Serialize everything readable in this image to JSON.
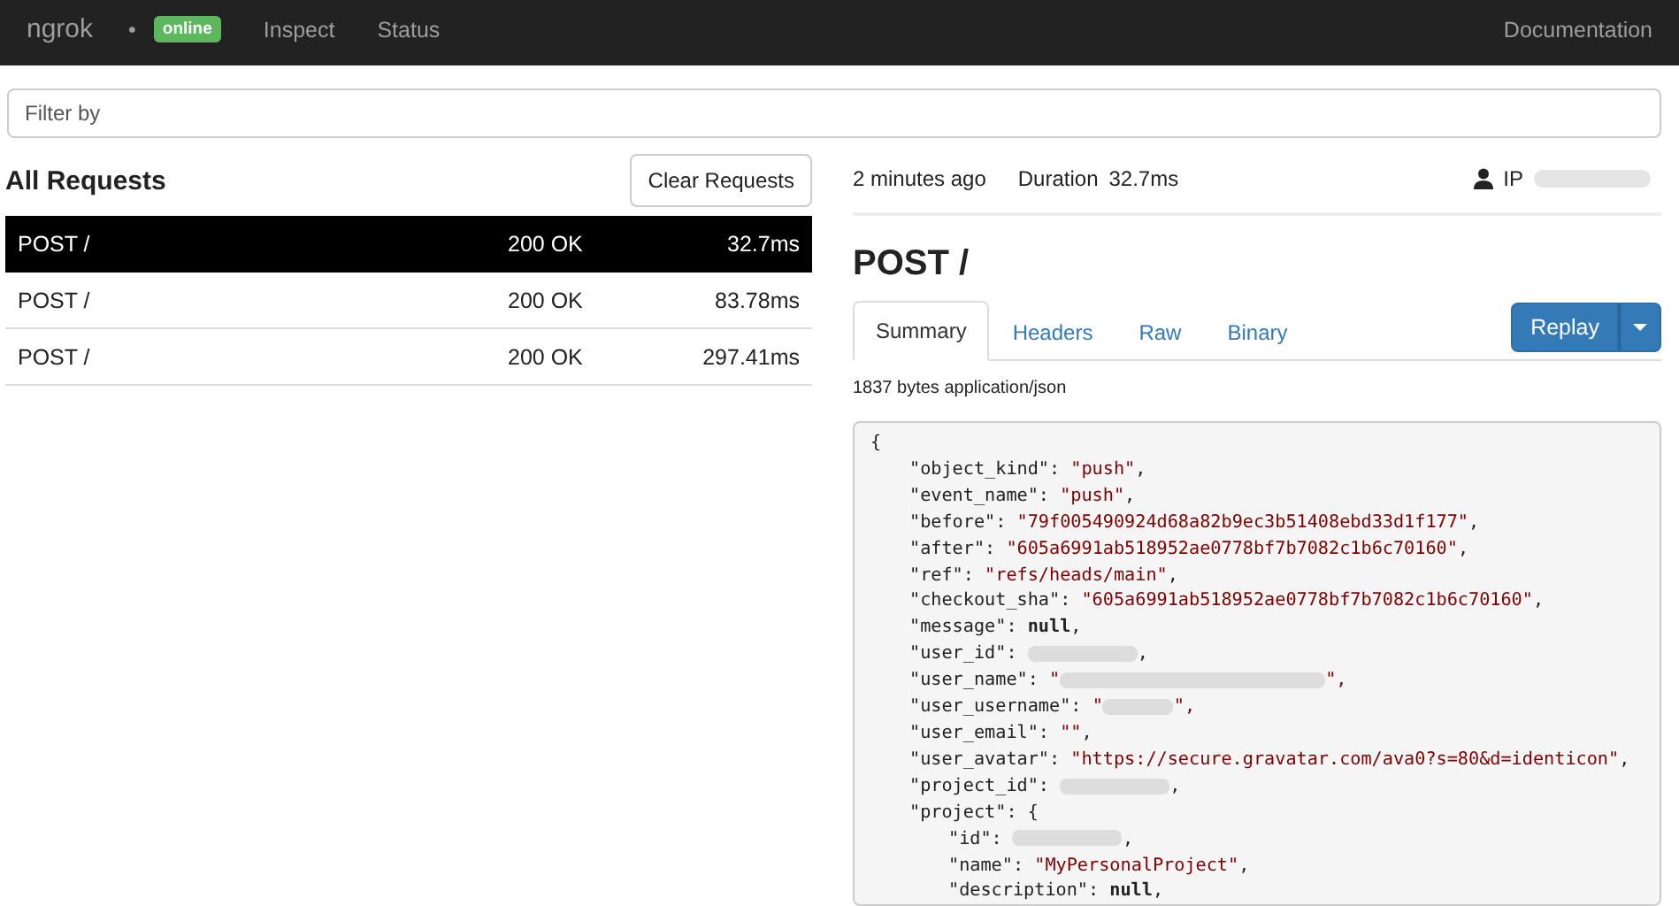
{
  "navbar": {
    "brand": "ngrok",
    "separator": "•",
    "status_badge": "online",
    "links": [
      {
        "label": "Inspect"
      },
      {
        "label": "Status"
      }
    ],
    "right_link": "Documentation"
  },
  "filter": {
    "placeholder": "Filter by"
  },
  "requests": {
    "title": "All Requests",
    "clear_button": "Clear Requests",
    "rows": [
      {
        "method": "POST /",
        "status": "200 OK",
        "duration": "32.7ms",
        "selected": true
      },
      {
        "method": "POST /",
        "status": "200 OK",
        "duration": "83.78ms",
        "selected": false
      },
      {
        "method": "POST /",
        "status": "200 OK",
        "duration": "297.41ms",
        "selected": false
      }
    ]
  },
  "detail": {
    "time": "2 minutes ago",
    "duration_label": "Duration",
    "duration_value": "32.7ms",
    "ip_label": "IP",
    "title": "POST /",
    "tabs": [
      {
        "label": "Summary",
        "selected": true
      },
      {
        "label": "Headers",
        "selected": false
      },
      {
        "label": "Raw",
        "selected": false
      },
      {
        "label": "Binary",
        "selected": false
      }
    ],
    "replay_button": "Replay",
    "summary": "1837 bytes application/json",
    "body": [
      {
        "kind": "brace",
        "key": "{"
      },
      {
        "kind": "string",
        "key": "\"object_kind\": ",
        "value": "\"push\"",
        "end": ","
      },
      {
        "kind": "string",
        "key": "\"event_name\": ",
        "value": "\"push\"",
        "end": ","
      },
      {
        "kind": "string",
        "key": "\"before\": ",
        "value": "\"79f005490924d68a82b9ec3b51408ebd33d1f177\"",
        "end": ","
      },
      {
        "kind": "string",
        "key": "\"after\": ",
        "value": "\"605a6991ab518952ae0778bf7b7082c1b6c70160\"",
        "end": ","
      },
      {
        "kind": "string",
        "key": "\"ref\": ",
        "value": "\"refs/heads/main\"",
        "end": ","
      },
      {
        "kind": "string",
        "key": "\"checkout_sha\": ",
        "value": "\"605a6991ab518952ae0778bf7b7082c1b6c70160\"",
        "end": ","
      },
      {
        "kind": "literal",
        "key": "\"message\": ",
        "value": "null",
        "end": ","
      },
      {
        "kind": "redacted",
        "key": "\"user_id\": ",
        "end": ","
      },
      {
        "kind": "redacted_string",
        "key": "\"user_name\": ",
        "value": "\"",
        "end": "\","
      },
      {
        "kind": "redacted_string",
        "key": "\"user_username\": ",
        "value": "\"",
        "end": "\","
      },
      {
        "kind": "string",
        "key": "\"user_email\": ",
        "value": "\"\"",
        "end": ","
      },
      {
        "kind": "string",
        "key": "\"user_avatar\": ",
        "value": "\"https://secure.gravatar.com/ava0?s=80&d=identicon\"",
        "end": ","
      },
      {
        "kind": "redacted",
        "key": "\"project_id\": ",
        "end": ","
      },
      {
        "kind": "open",
        "key": "\"project\": ",
        "value": "{",
        "children": [
          {
            "kind": "redacted",
            "key": "\"id\": ",
            "end": ","
          },
          {
            "kind": "string",
            "key": "\"name\": ",
            "value": "\"MyPersonalProject\"",
            "end": ","
          },
          {
            "kind": "literal",
            "key": "\"description\": ",
            "value": "null",
            "end": ","
          }
        ]
      }
    ]
  }
}
